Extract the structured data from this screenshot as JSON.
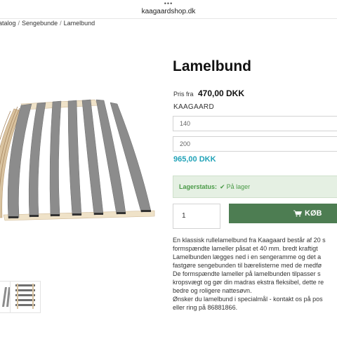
{
  "browser": {
    "dots": "•••",
    "domain": "kaagaardshop.dk"
  },
  "breadcrumb": {
    "items": [
      "atalog",
      "Sengebunde",
      "Lamelbund"
    ],
    "separator": "/"
  },
  "product": {
    "title": "Lamelbund",
    "price_label": "Pris fra",
    "price_value": "470,00 DKK",
    "brand": "KAAGAARD",
    "option_width": "140",
    "option_length": "200",
    "total_price": "965,00 DKK",
    "stock_label": "Lagerstatus:",
    "stock_check": "✔",
    "stock_value": "På lager",
    "quantity": "1",
    "buy_label": "KØB",
    "description": [
      "En klassisk rullelamelbund fra Kaagaard består af 20 s",
      "formspændte lameller påsat et 40 mm. bredt kraftigt",
      "Lamelbunden lægges ned i en sengeramme og det a",
      "fastgøre sengebunden til bærelisterne med de medfø",
      "De formspændte lameller på lamelbunden tilpasser s",
      "kropsvægt og gør din madras ekstra fleksibel, dette re",
      "bedre og roligere nattesøvn.",
      "Ønsker du lamelbund i specialmål - kontakt os på pos",
      "eller ring på 86881866."
    ]
  },
  "colors": {
    "accent_teal": "#22a3b8",
    "buy_green": "#4d7d52",
    "stock_bg": "#e5f0e3",
    "stock_text": "#4a9a47",
    "slat_grey": "#8f8f8f",
    "wood": "#e8d6b8"
  },
  "icons": {
    "stock": "check-icon",
    "buy": "shopping-cart-icon"
  }
}
